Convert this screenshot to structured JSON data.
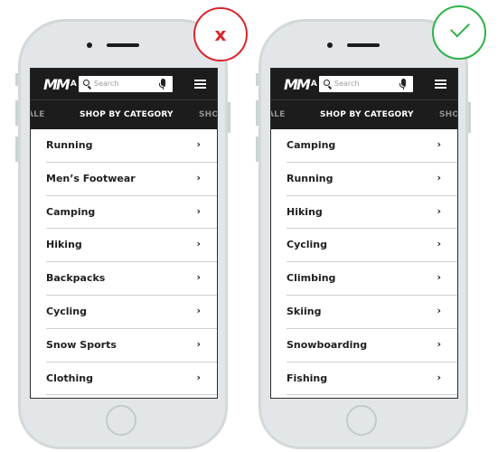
{
  "comparison": {
    "bad_badge": {
      "icon": "x-icon",
      "glyph": "x",
      "color": "#d9262c"
    },
    "good_badge": {
      "icon": "checkmark-icon",
      "color": "#2fb24a"
    }
  },
  "phones": [
    {
      "variant": "bad",
      "header": {
        "logo_text": "M",
        "logo_suffix": "A",
        "search_placeholder": "Search",
        "search_icon": "search-icon",
        "mic_icon": "microphone-icon",
        "menu_icon": "hamburger-menu-icon"
      },
      "nav": {
        "prev": "ALE",
        "current": "SHOP BY CATEGORY",
        "next": "SHO"
      },
      "categories": [
        {
          "label": "Running",
          "chevron": "›"
        },
        {
          "label": "Men’s Footwear",
          "chevron": "›"
        },
        {
          "label": "Camping",
          "chevron": "›"
        },
        {
          "label": "Hiking",
          "chevron": "›"
        },
        {
          "label": "Backpacks",
          "chevron": "›"
        },
        {
          "label": "Cycling",
          "chevron": "›"
        },
        {
          "label": "Snow Sports",
          "chevron": "›"
        },
        {
          "label": "Clothing",
          "chevron": "›"
        }
      ]
    },
    {
      "variant": "good",
      "header": {
        "logo_text": "M",
        "logo_suffix": "A",
        "search_placeholder": "Search",
        "search_icon": "search-icon",
        "mic_icon": "microphone-icon",
        "menu_icon": "hamburger-menu-icon"
      },
      "nav": {
        "prev": "ALE",
        "current": "SHOP BY CATEGORY",
        "next": "SHO"
      },
      "categories": [
        {
          "label": "Camping",
          "chevron": "›"
        },
        {
          "label": "Running",
          "chevron": "›"
        },
        {
          "label": "Hiking",
          "chevron": "›"
        },
        {
          "label": "Cycling",
          "chevron": "›"
        },
        {
          "label": "Climbing",
          "chevron": "›"
        },
        {
          "label": "Skiing",
          "chevron": "›"
        },
        {
          "label": "Snowboarding",
          "chevron": "›"
        },
        {
          "label": "Fishing",
          "chevron": "›"
        }
      ]
    }
  ]
}
